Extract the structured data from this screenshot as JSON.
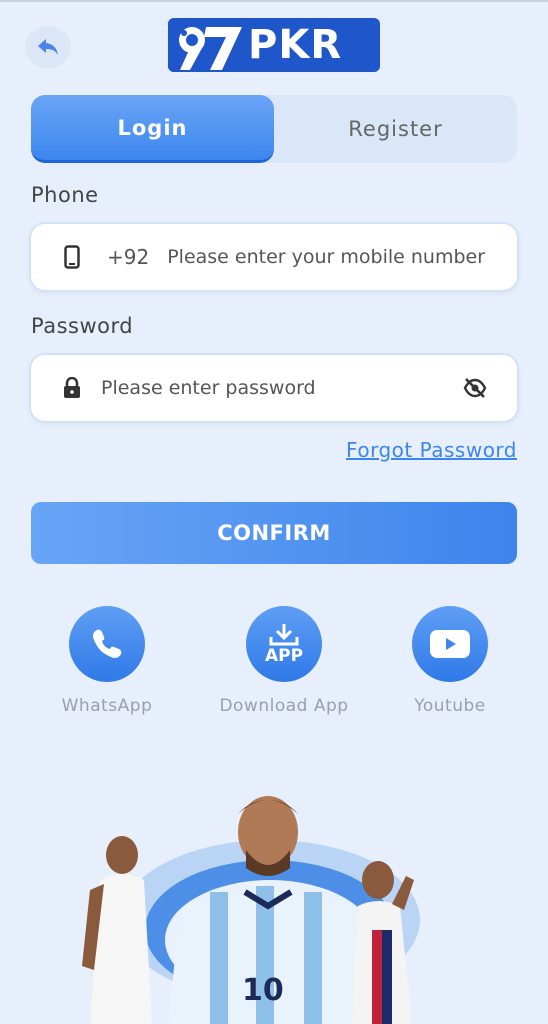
{
  "header": {
    "logo_text": "PKR",
    "logo_number": "97"
  },
  "tabs": {
    "login": "Login",
    "register": "Register"
  },
  "phone": {
    "label": "Phone",
    "country_code": "+92",
    "placeholder": "Please enter your mobile number"
  },
  "password": {
    "label": "Password",
    "placeholder": "Please enter password"
  },
  "forgot_password": "Forgot Password",
  "confirm_label": "CONFIRM",
  "social": [
    {
      "label": "WhatsApp",
      "icon": "phone-icon"
    },
    {
      "label": "Download App",
      "icon": "download-app-icon",
      "badge": "APP"
    },
    {
      "label": "Youtube",
      "icon": "youtube-icon"
    }
  ],
  "colors": {
    "accent": "#3d86ee",
    "background": "#e6effb"
  }
}
